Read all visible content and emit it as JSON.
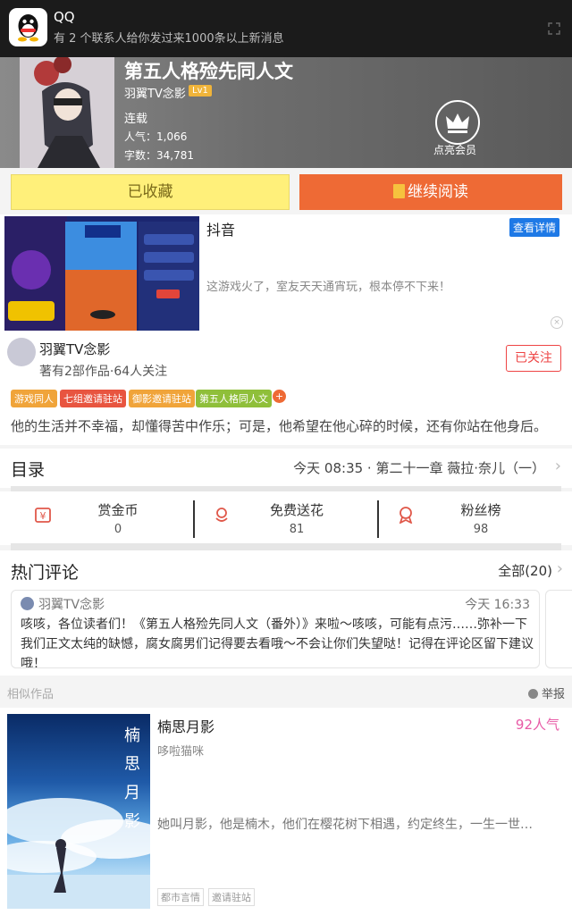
{
  "notification": {
    "app": "QQ",
    "message": "有 2 个联系人给你发过来1000条以上新消息"
  },
  "book": {
    "title": "第五人格殓先同人文",
    "author": "羽翼TV念影",
    "level": "Lv1",
    "status": "连载",
    "popularity": "人气：1,066",
    "words": "字数：34,781",
    "vip_label": "点亮会员"
  },
  "actions": {
    "favorited": "已收藏",
    "continue_reading": "继续阅读"
  },
  "ad": {
    "title": "抖音",
    "detail_button": "查看详情",
    "description": "这游戏火了，室友天天通宵玩，根本停不下来！",
    "close": "×"
  },
  "author_card": {
    "name": "羽翼TV念影",
    "stats": "著有2部作品·64人关注",
    "follow_button": "已关注"
  },
  "tags": [
    {
      "label": "游戏同人",
      "color": "#f0a43a"
    },
    {
      "label": "七组邀请驻站",
      "color": "#e85540"
    },
    {
      "label": "御影邀请驻站",
      "color": "#f0a43a"
    },
    {
      "label": "第五人格同人文",
      "color": "#8fbf3a"
    }
  ],
  "tag_more": "+",
  "intro": "他的生活并不幸福，却懂得苦中作乐；可是，他希望在他心碎的时候，还有你站在他身后。",
  "toc": {
    "label": "目录",
    "latest": "今天 08:35 · 第二十一章 薇拉·奈儿（一）"
  },
  "stats": [
    {
      "label": "赏金币",
      "value": "0",
      "icon": "coin-icon"
    },
    {
      "label": "免费送花",
      "value": "81",
      "icon": "flower-icon"
    },
    {
      "label": "粉丝榜",
      "value": "98",
      "icon": "medal-icon"
    }
  ],
  "comments": {
    "title": "热门评论",
    "all": "全部(20)",
    "items": [
      {
        "user": "羽翼TV念影",
        "time": "今天 16:33",
        "body": "咳咳，各位读者们！《第五人格殓先同人文（番外）》来啦～咳咳，可能有点污……弥补一下我们正文太纯的缺憾，腐女腐男们记得要去看哦～不会让你们失望哒！记得在评论区留下建议哦！"
      }
    ]
  },
  "similar": {
    "title": "相似作品",
    "report": "举报",
    "book": {
      "title": "楠思月影",
      "popularity": "92人气",
      "author": "哆啦猫咪",
      "description": "她叫月影，他是楠木，他们在樱花树下相遇，约定终生，一生一世…",
      "tags": [
        "都市言情",
        "邀请驻站"
      ]
    }
  },
  "colors": {
    "accent": "#ee6a35",
    "favorite": "#fff07a",
    "follow": "#e44444",
    "popularity": "#e85aa6"
  }
}
